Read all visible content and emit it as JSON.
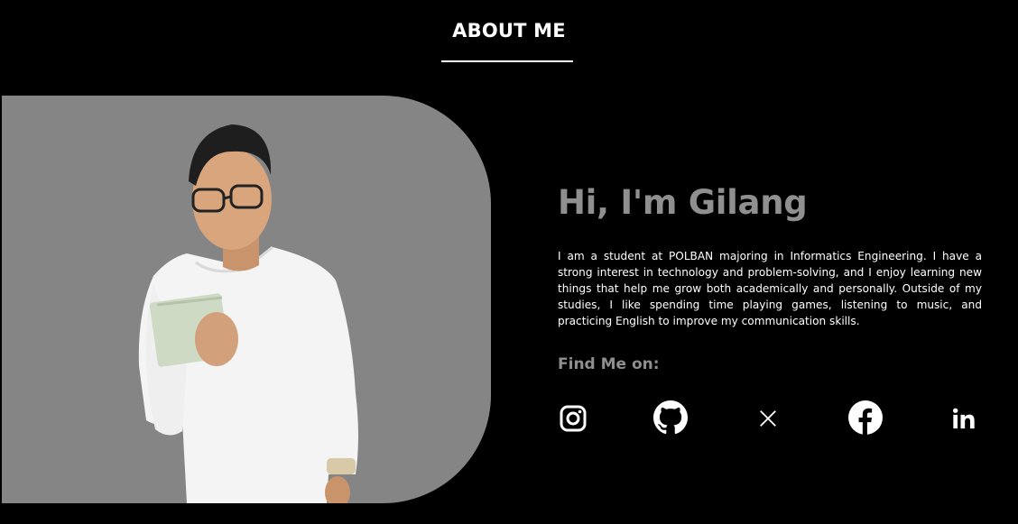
{
  "header": {
    "title": "ABOUT ME"
  },
  "about": {
    "greeting": "Hi, I'm Gilang",
    "bio": "I am a student at POLBAN majoring in Informatics Engineering. I have a strong interest in technology and problem-solving, and I enjoy learning new things that help me grow both academically and personally. Outside of my studies, I like spending time playing games, listening to music, and practicing English to improve my communication skills.",
    "find_me_label": "Find Me on:"
  },
  "socials": [
    {
      "name": "instagram",
      "icon": "instagram-icon"
    },
    {
      "name": "github",
      "icon": "github-icon"
    },
    {
      "name": "x",
      "icon": "x-icon"
    },
    {
      "name": "facebook",
      "icon": "facebook-icon"
    },
    {
      "name": "linkedin",
      "icon": "linkedin-icon"
    }
  ],
  "colors": {
    "background": "#000000",
    "panel": "#858585",
    "muted_heading": "#8f8f8f",
    "text": "#ffffff"
  }
}
